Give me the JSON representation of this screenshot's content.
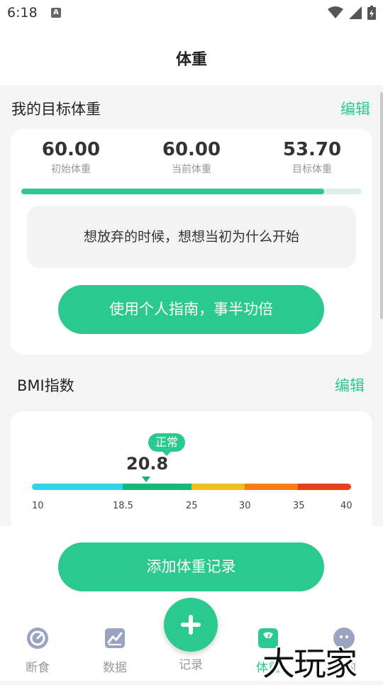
{
  "status_bar": {
    "time": "6:18",
    "notif_icon": "A"
  },
  "header": {
    "title": "体重"
  },
  "target_section": {
    "title": "我的目标体重",
    "edit_label": "编辑",
    "initial": {
      "value": "60.00",
      "label": "初始体重"
    },
    "current": {
      "value": "60.00",
      "label": "当前体重"
    },
    "target": {
      "value": "53.70",
      "label": "目标体重"
    },
    "progress_fraction": 0.89,
    "quote": "想放弃的时候，想想当初为什么开始",
    "guide_button": "使用个人指南，事半功倍"
  },
  "bmi_section": {
    "title": "BMI指数",
    "edit_label": "编辑",
    "status_badge": "正常",
    "value": "20.8",
    "ticks": [
      "10",
      "18.5",
      "25",
      "30",
      "35",
      "40"
    ],
    "segment_colors": [
      "#2fd4ea",
      "#16b77a",
      "#f3bd1c",
      "#f47f13",
      "#e5421c"
    ]
  },
  "add_button": "添加体重记录",
  "tabs": [
    {
      "label": "断食",
      "icon": "gauge-icon",
      "active": false
    },
    {
      "label": "数据",
      "icon": "chart-icon",
      "active": false
    },
    {
      "label": "记录",
      "icon": "plus-icon",
      "active": false
    },
    {
      "label": "体重",
      "icon": "scale-icon",
      "active": true
    },
    {
      "label": "我的",
      "icon": "profile-icon",
      "active": false
    }
  ],
  "watermark": "大玩家",
  "colors": {
    "accent": "#2bc98f"
  }
}
